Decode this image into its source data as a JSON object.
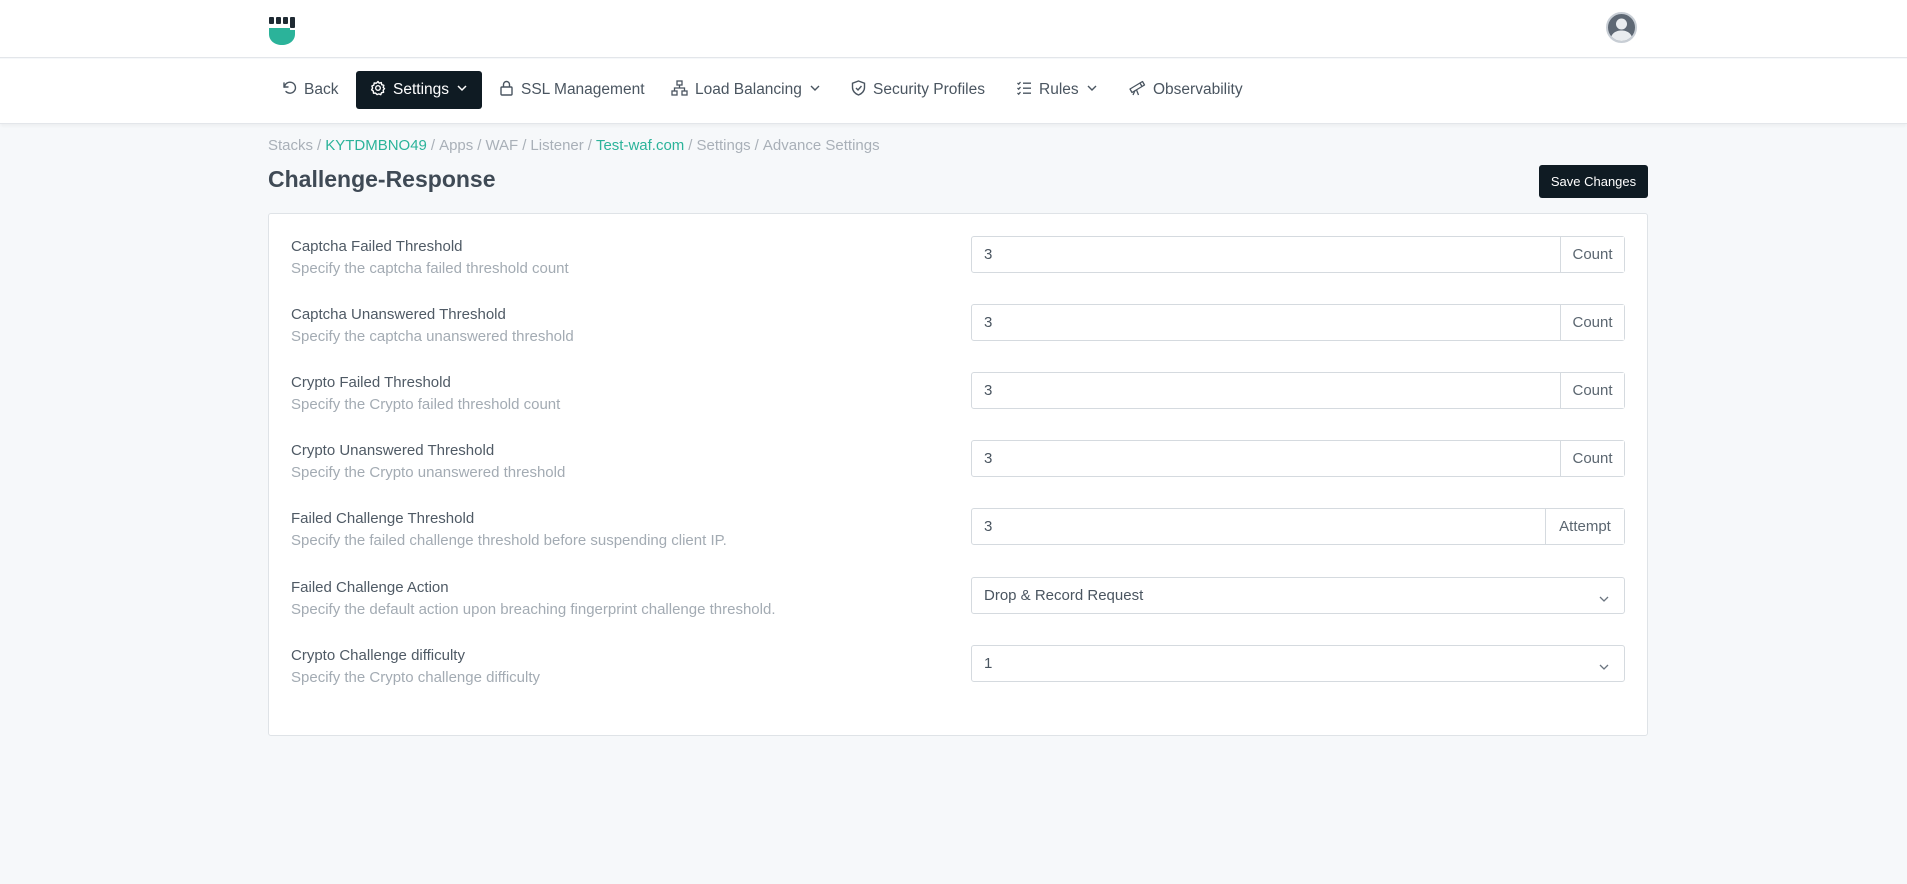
{
  "nav": {
    "back": "Back",
    "settings": "Settings",
    "ssl": "SSL Management",
    "load_balancing": "Load Balancing",
    "security_profiles": "Security Profiles",
    "rules": "Rules",
    "observability": "Observability"
  },
  "breadcrumb": {
    "stacks": "Stacks",
    "stack_id": "KYTDMBNO49",
    "apps": "Apps",
    "waf": "WAF",
    "listener": "Listener",
    "domain": "Test-waf.com",
    "settings": "Settings",
    "current": "Advance Settings",
    "separator": "/"
  },
  "page": {
    "title": "Challenge-Response",
    "save_label": "Save Changes"
  },
  "fields": [
    {
      "label": "Captcha Failed Threshold",
      "desc": "Specify the captcha failed threshold count",
      "value": "3",
      "unit": "Count"
    },
    {
      "label": "Captcha Unanswered Threshold",
      "desc": "Specify the captcha unanswered threshold",
      "value": "3",
      "unit": "Count"
    },
    {
      "label": "Crypto Failed Threshold",
      "desc": "Specify the Crypto failed threshold count",
      "value": "3",
      "unit": "Count"
    },
    {
      "label": "Crypto Unanswered Threshold",
      "desc": "Specify the Crypto unanswered threshold",
      "value": "3",
      "unit": "Count"
    },
    {
      "label": "Failed Challenge Threshold",
      "desc": "Specify the failed challenge threshold before suspending client IP.",
      "value": "3",
      "unit": "Attempt"
    },
    {
      "label": "Failed Challenge Action",
      "desc": "Specify the default action upon breaching fingerprint challenge threshold.",
      "selected": "Drop & Record Request"
    },
    {
      "label": "Crypto Challenge difficulty",
      "desc": "Specify the Crypto challenge difficulty",
      "selected": "1"
    }
  ],
  "colors": {
    "accent": "#2bb39a",
    "dark": "#0f1b23",
    "background": "#f6f8fa"
  }
}
